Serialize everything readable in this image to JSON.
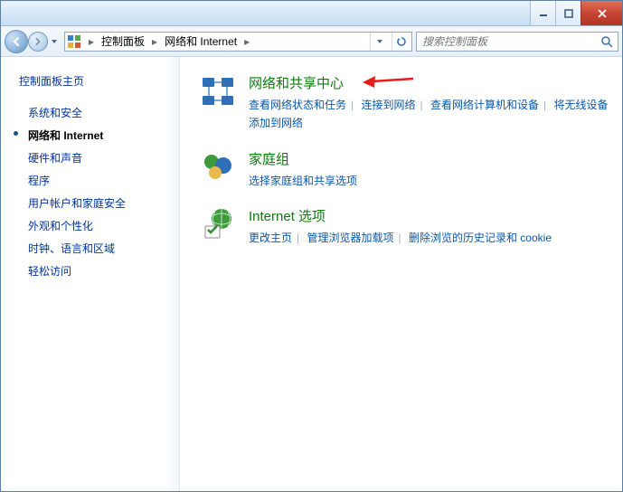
{
  "breadcrumb": {
    "item1": "控制面板",
    "item2": "网络和 Internet"
  },
  "search": {
    "placeholder": "搜索控制面板"
  },
  "sidebar": {
    "title": "控制面板主页",
    "items": [
      {
        "label": "系统和安全"
      },
      {
        "label": "网络和 Internet",
        "active": true
      },
      {
        "label": "硬件和声音"
      },
      {
        "label": "程序"
      },
      {
        "label": "用户帐户和家庭安全"
      },
      {
        "label": "外观和个性化"
      },
      {
        "label": "时钟、语言和区域"
      },
      {
        "label": "轻松访问"
      }
    ]
  },
  "categories": [
    {
      "title": "网络和共享中心",
      "links": [
        "查看网络状态和任务",
        "连接到网络",
        "查看网络计算机和设备",
        "将无线设备添加到网络"
      ]
    },
    {
      "title": "家庭组",
      "links": [
        "选择家庭组和共享选项"
      ]
    },
    {
      "title": "Internet 选项",
      "links": [
        "更改主页",
        "管理浏览器加载项",
        "删除浏览的历史记录和 cookie"
      ]
    }
  ]
}
